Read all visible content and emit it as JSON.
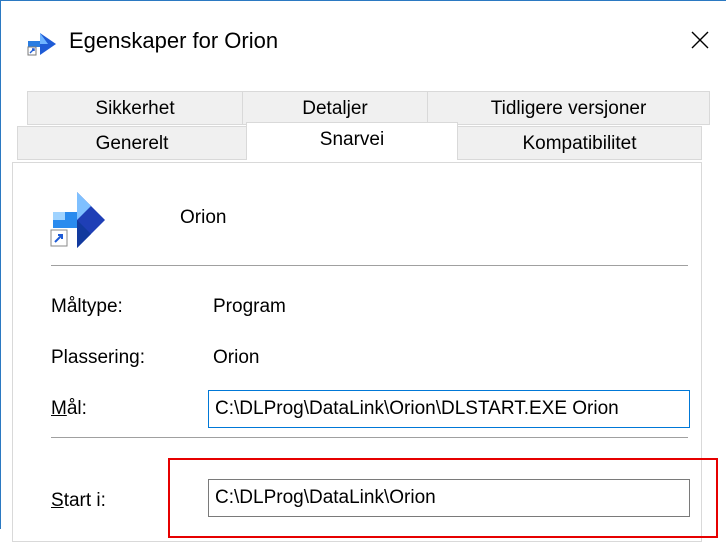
{
  "window": {
    "title": "Egenskaper for Orion",
    "app_icon": "shortcut-app-icon",
    "close_icon": "close-icon"
  },
  "tabs": {
    "row1": [
      "Sikkerhet",
      "Detaljer",
      "Tidligere versjoner"
    ],
    "row2": [
      "Generelt",
      "Snarvei",
      "Kompatibilitet"
    ],
    "active": "Snarvei"
  },
  "shortcut": {
    "name": "Orion",
    "target_type_label": "Måltype:",
    "target_type_value": "Program",
    "location_label": "Plassering:",
    "location_value": "Orion",
    "target_label_mnemonic": "M",
    "target_label_rest": "ål:",
    "target_value": "C:\\DLProg\\DataLink\\Orion\\DLSTART.EXE Orion",
    "start_in_label_mnemonic": "S",
    "start_in_label_rest": "tart i:",
    "start_in_value": "C:\\DLProg\\DataLink\\Orion"
  },
  "colors": {
    "focus_border": "#0078d7",
    "highlight_box": "#e60000",
    "window_border": "#2b79c2"
  }
}
